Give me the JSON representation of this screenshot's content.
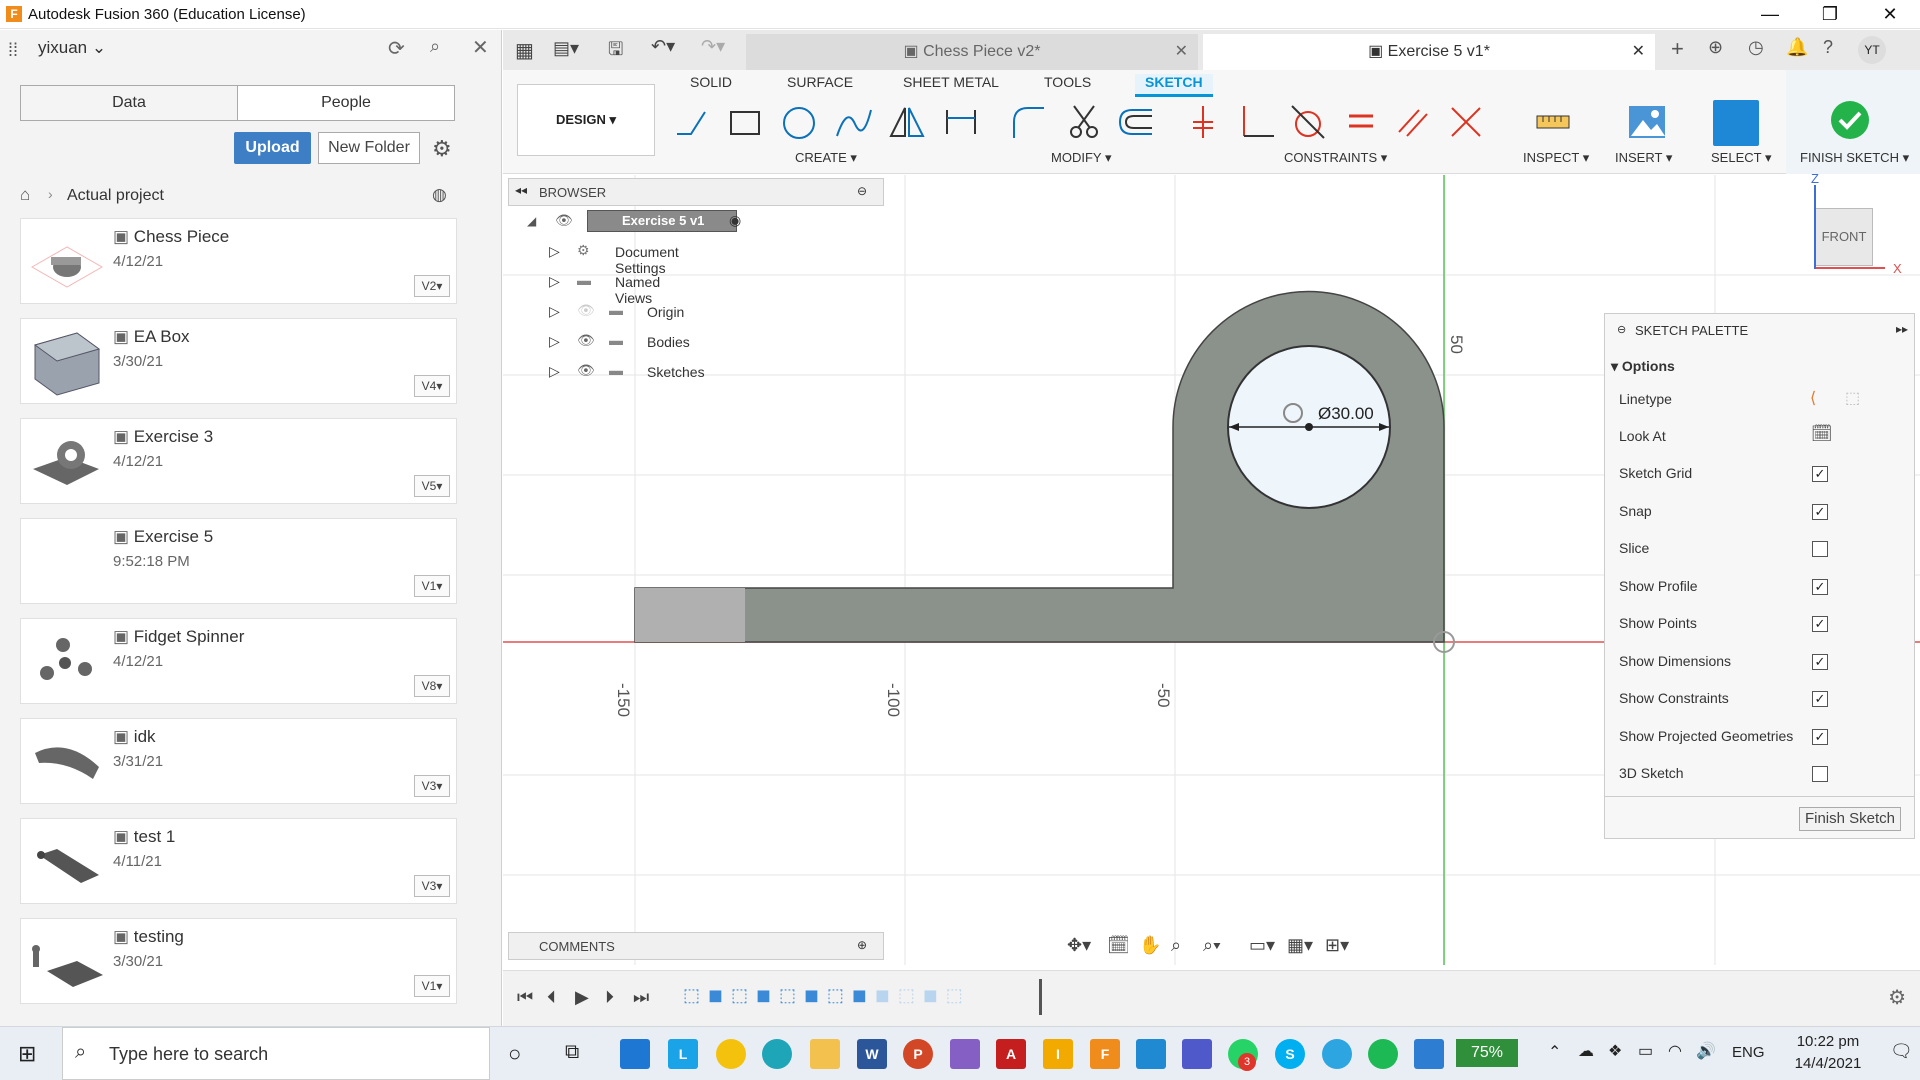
{
  "window": {
    "title": "Autodesk Fusion 360 (Education License)"
  },
  "data_panel": {
    "user": "yixuan",
    "tabs": [
      "Data",
      "People"
    ],
    "upload_label": "Upload",
    "new_folder_label": "New Folder",
    "breadcrumb": "Actual project",
    "items": [
      {
        "name": "Chess Piece",
        "date": "4/12/21",
        "version": "V2"
      },
      {
        "name": "EA Box",
        "date": "3/30/21",
        "version": "V4"
      },
      {
        "name": "Exercise 3",
        "date": "4/12/21",
        "version": "V5"
      },
      {
        "name": "Exercise 5",
        "date": "9:52:18 PM",
        "version": "V1"
      },
      {
        "name": "Fidget Spinner",
        "date": "4/12/21",
        "version": "V8"
      },
      {
        "name": "idk",
        "date": "3/31/21",
        "version": "V3"
      },
      {
        "name": "test 1",
        "date": "4/11/21",
        "version": "V3"
      },
      {
        "name": "testing",
        "date": "3/30/21",
        "version": "V1"
      }
    ]
  },
  "doc_tabs": [
    {
      "label": "Chess Piece v2*",
      "active": false
    },
    {
      "label": "Exercise 5 v1*",
      "active": true
    }
  ],
  "user_initials": "YT",
  "toolbar": {
    "workspace": "DESIGN",
    "tabs": [
      "SOLID",
      "SURFACE",
      "SHEET METAL",
      "TOOLS",
      "SKETCH"
    ],
    "active_tab": "SKETCH",
    "groups": [
      "CREATE",
      "MODIFY",
      "CONSTRAINTS",
      "INSPECT",
      "INSERT",
      "SELECT",
      "FINISH SKETCH"
    ]
  },
  "browser": {
    "title": "BROWSER",
    "root": "Exercise 5 v1",
    "nodes": [
      "Document Settings",
      "Named Views",
      "Origin",
      "Bodies",
      "Sketches"
    ]
  },
  "sketch": {
    "dimension": "Ø30.00",
    "axis_labels": [
      "-150",
      "-100",
      "-50",
      "50"
    ],
    "view_cube": "FRONT",
    "axis_z": "Z",
    "axis_x": "X"
  },
  "palette": {
    "title": "SKETCH PALETTE",
    "section": "Options",
    "rows": [
      {
        "label": "Linetype",
        "kind": "icons"
      },
      {
        "label": "Look At",
        "kind": "icon"
      },
      {
        "label": "Sketch Grid",
        "checked": true
      },
      {
        "label": "Snap",
        "checked": true
      },
      {
        "label": "Slice",
        "checked": false
      },
      {
        "label": "Show Profile",
        "checked": true
      },
      {
        "label": "Show Points",
        "checked": true
      },
      {
        "label": "Show Dimensions",
        "checked": true
      },
      {
        "label": "Show Constraints",
        "checked": true
      },
      {
        "label": "Show Projected Geometries",
        "checked": true
      },
      {
        "label": "3D Sketch",
        "checked": false
      }
    ],
    "finish_label": "Finish Sketch"
  },
  "comments_label": "COMMENTS",
  "taskbar": {
    "search_placeholder": "Type here to search",
    "battery": "75%",
    "language": "ENG",
    "time": "10:22 pm",
    "date": "14/4/2021",
    "whatsapp_badge": "3"
  },
  "colors": {
    "accent": "#0696d7",
    "upload": "#3d7ec4",
    "body_fill": "#8b918b",
    "finish_green": "#1db954"
  }
}
